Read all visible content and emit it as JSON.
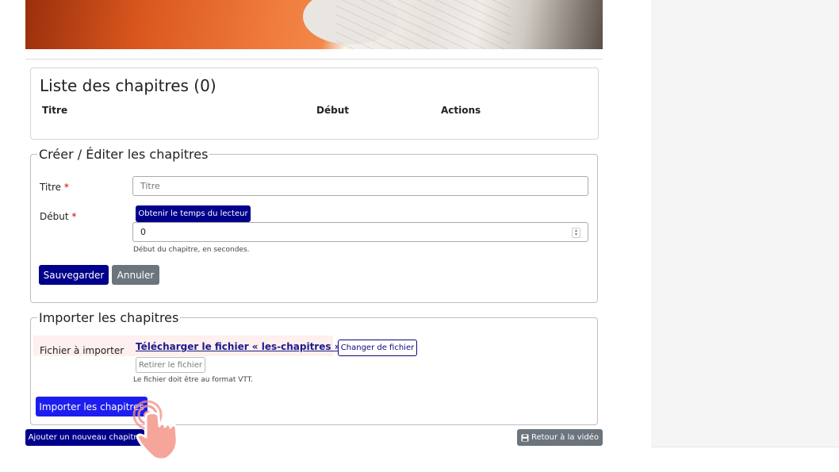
{
  "chapters": {
    "title": "Liste des chapitres (0)",
    "columns": [
      "Titre",
      "Début",
      "Actions"
    ]
  },
  "create": {
    "legend": "Créer / Éditer les chapitres",
    "title_label": "Titre",
    "title_placeholder": "Titre",
    "start_label": "Début",
    "required_mark": "*",
    "get_time_button": "Obtenir le temps du lecteur",
    "start_value": "0",
    "start_help": "Début du chapitre, en secondes.",
    "save_button": "Sauvegarder",
    "cancel_button": "Annuler"
  },
  "import": {
    "legend": "Importer les chapitres",
    "file_label": "Fichier à importer",
    "file_link": "Télécharger le fichier « les-chapitres ».",
    "change_file_button": "Changer de fichier",
    "remove_file_button": "Retirer le fichier",
    "file_help": "Le fichier doit être au format VTT.",
    "import_button": "Importer les chapitres"
  },
  "footer": {
    "add_chapter_button": "Ajouter un nouveau chapitre",
    "back_button": "Retour à la vidéo",
    "back_icon": "save-icon"
  },
  "colors": {
    "primary": "#00008b",
    "secondary": "#6c757d",
    "accent": "#1d1df0",
    "required": "#d00000"
  }
}
